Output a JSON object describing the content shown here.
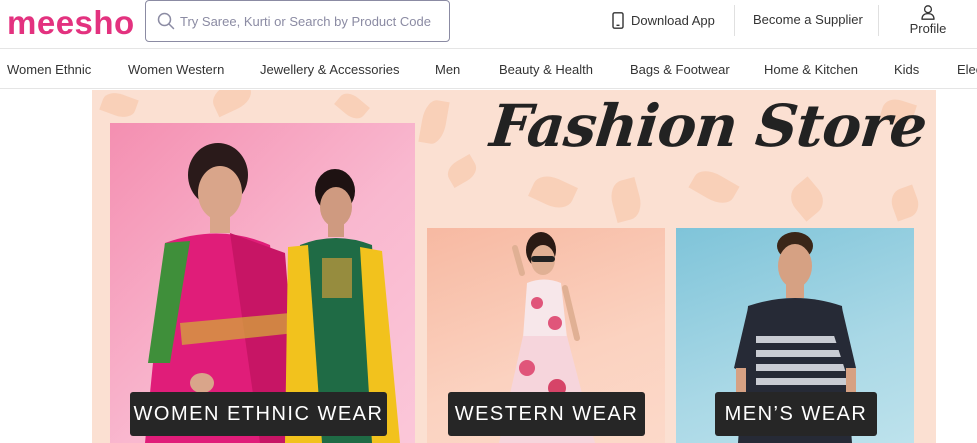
{
  "header": {
    "logo": "meesho",
    "search_placeholder": "Try Saree, Kurti or Search by Product Code",
    "download_app": "Download App",
    "become_supplier": "Become a Supplier",
    "profile": "Profile"
  },
  "categories": [
    "Women Ethnic",
    "Women Western",
    "Jewellery & Accessories",
    "Men",
    "Beauty & Health",
    "Bags & Footwear",
    "Home & Kitchen",
    "Kids",
    "Electronics"
  ],
  "banner": {
    "title": "Fashion Store",
    "panels": [
      {
        "cta": "WOMEN ETHNIC WEAR"
      },
      {
        "cta": "WESTERN WEAR"
      },
      {
        "cta": "MEN’S WEAR"
      }
    ]
  },
  "colors": {
    "brand": "#e3327f",
    "banner_bg": "#fbe0d2",
    "cta_bg": "#262626"
  },
  "icons": [
    "search-icon",
    "mobile-phone-icon",
    "user-icon"
  ]
}
